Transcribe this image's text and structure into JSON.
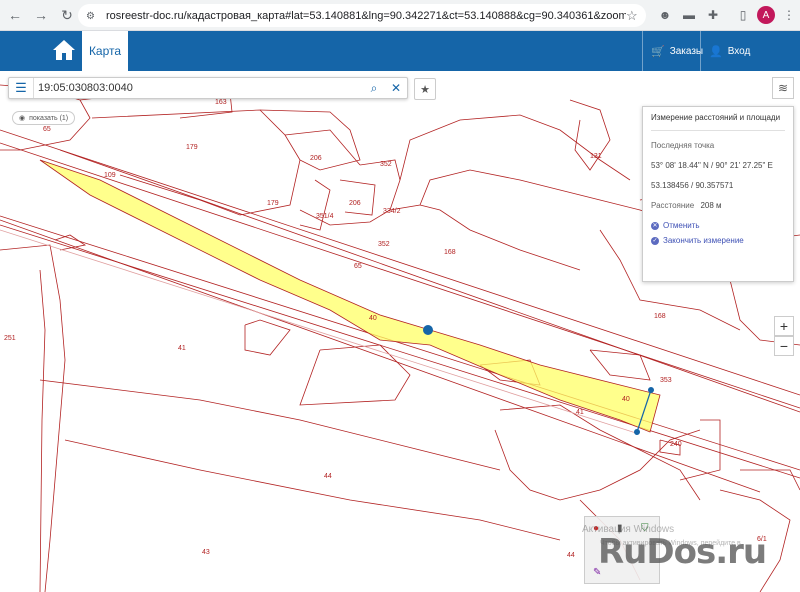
{
  "browser": {
    "url": "rosreestr-doc.ru/кадастровая_карта#lat=53.140881&lng=90.342271&ct=53.140888&cg=90.340361&zoom=15",
    "avatar_letter": "A"
  },
  "header": {
    "tab_map": "Карта",
    "orders": "Заказы",
    "login": "Вход"
  },
  "search": {
    "value": "19:05:030803:0040",
    "show_label": "показать (1)"
  },
  "measure_panel": {
    "title": "Измерение расстояний и площади",
    "last_point_label": "Последняя точка",
    "coords_dms": "53° 08' 18.44\" N / 90° 21' 27.25\" E",
    "coords_decimal": "53.138456 / 90.357571",
    "distance_label": "Расстояние",
    "distance_value": "208 м",
    "cancel": "Отменить",
    "finish": "Закончить измерение"
  },
  "zoom": {
    "in": "+",
    "out": "−"
  },
  "map_labels": [
    "163",
    "65",
    "179",
    "206",
    "352",
    "109",
    "131",
    "179",
    "206",
    "351/4",
    "334/2",
    "352",
    "168",
    "65",
    "40",
    "168",
    "251",
    "41",
    "353",
    "41",
    "40",
    "240",
    "44",
    "43",
    "6/1",
    "44"
  ],
  "watermark": {
    "line1": "Активация Windows",
    "line2": "Чтобы активировать Windows, перейдите в",
    "brand": "RuDos.ru"
  },
  "colors": {
    "brand_blue": "#1565a8",
    "parcel_line": "#b22222",
    "highlight": "#ffff66",
    "link": "#3f51b5"
  }
}
